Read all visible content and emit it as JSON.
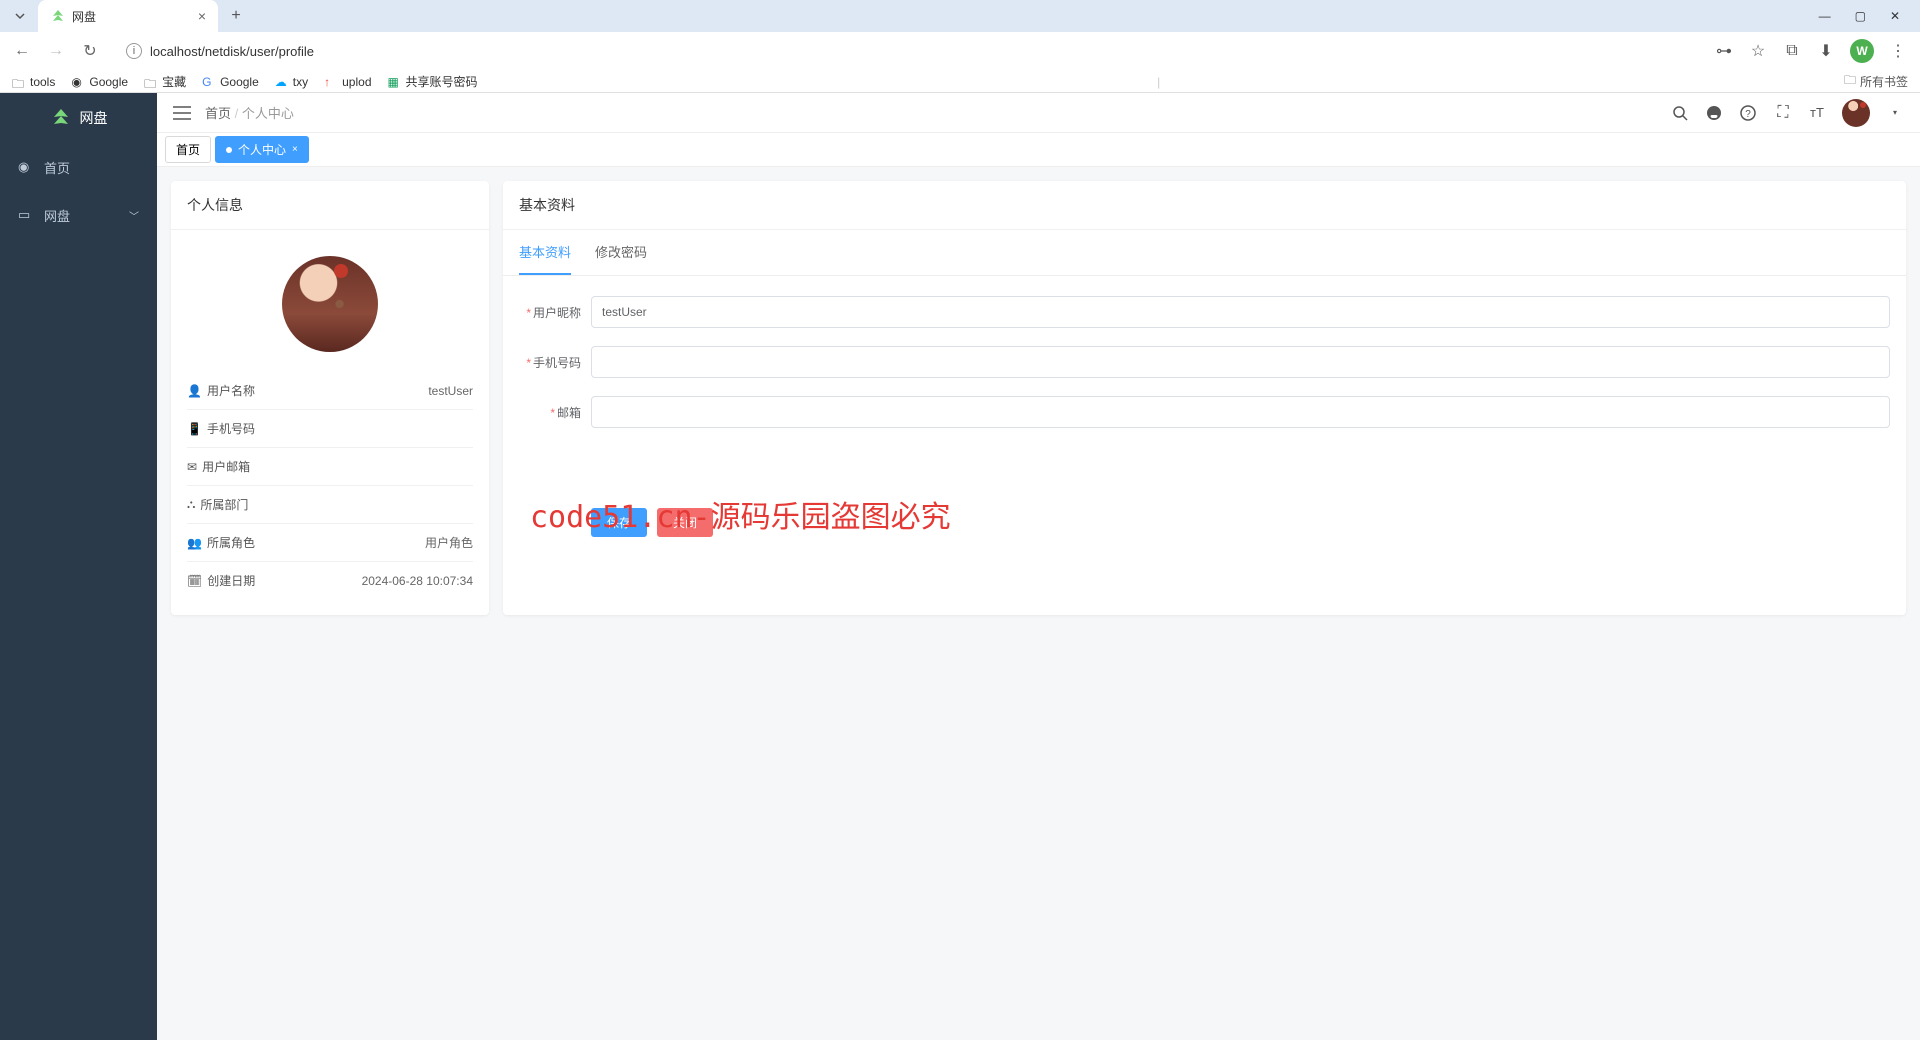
{
  "browser": {
    "tab_title": "网盘",
    "url": "localhost/netdisk/user/profile",
    "bookmarks": [
      "tools",
      "Google",
      "宝藏",
      "Google",
      "txy",
      "uplod",
      "共享账号密码"
    ],
    "all_bookmarks": "所有书签",
    "profile_initial": "W"
  },
  "sidebar": {
    "logo": "网盘",
    "items": [
      {
        "icon": "dashboard",
        "label": "首页"
      },
      {
        "icon": "disk",
        "label": "网盘"
      }
    ]
  },
  "topbar": {
    "breadcrumb_root": "首页",
    "breadcrumb_current": "个人中心"
  },
  "page_tabs": [
    {
      "label": "首页",
      "active": false
    },
    {
      "label": "个人中心",
      "active": true
    }
  ],
  "profile_card": {
    "title": "个人信息",
    "rows": [
      {
        "icon": "user",
        "label": "用户名称",
        "value": "testUser"
      },
      {
        "icon": "phone",
        "label": "手机号码",
        "value": ""
      },
      {
        "icon": "mail",
        "label": "用户邮箱",
        "value": ""
      },
      {
        "icon": "dept",
        "label": "所属部门",
        "value": ""
      },
      {
        "icon": "role",
        "label": "所属角色",
        "value": "用户角色"
      },
      {
        "icon": "date",
        "label": "创建日期",
        "value": "2024-06-28 10:07:34"
      }
    ]
  },
  "form_card": {
    "title": "基本资料",
    "tabs": [
      "基本资料",
      "修改密码"
    ],
    "active_tab": 0,
    "fields": {
      "nickname_label": "用户昵称",
      "nickname_value": "testUser",
      "phone_label": "手机号码",
      "phone_value": "",
      "email_label": "邮箱",
      "email_value": ""
    },
    "save_label": "保存",
    "close_label": "关闭"
  },
  "watermark": "code51.cn-源码乐园盗图必究"
}
